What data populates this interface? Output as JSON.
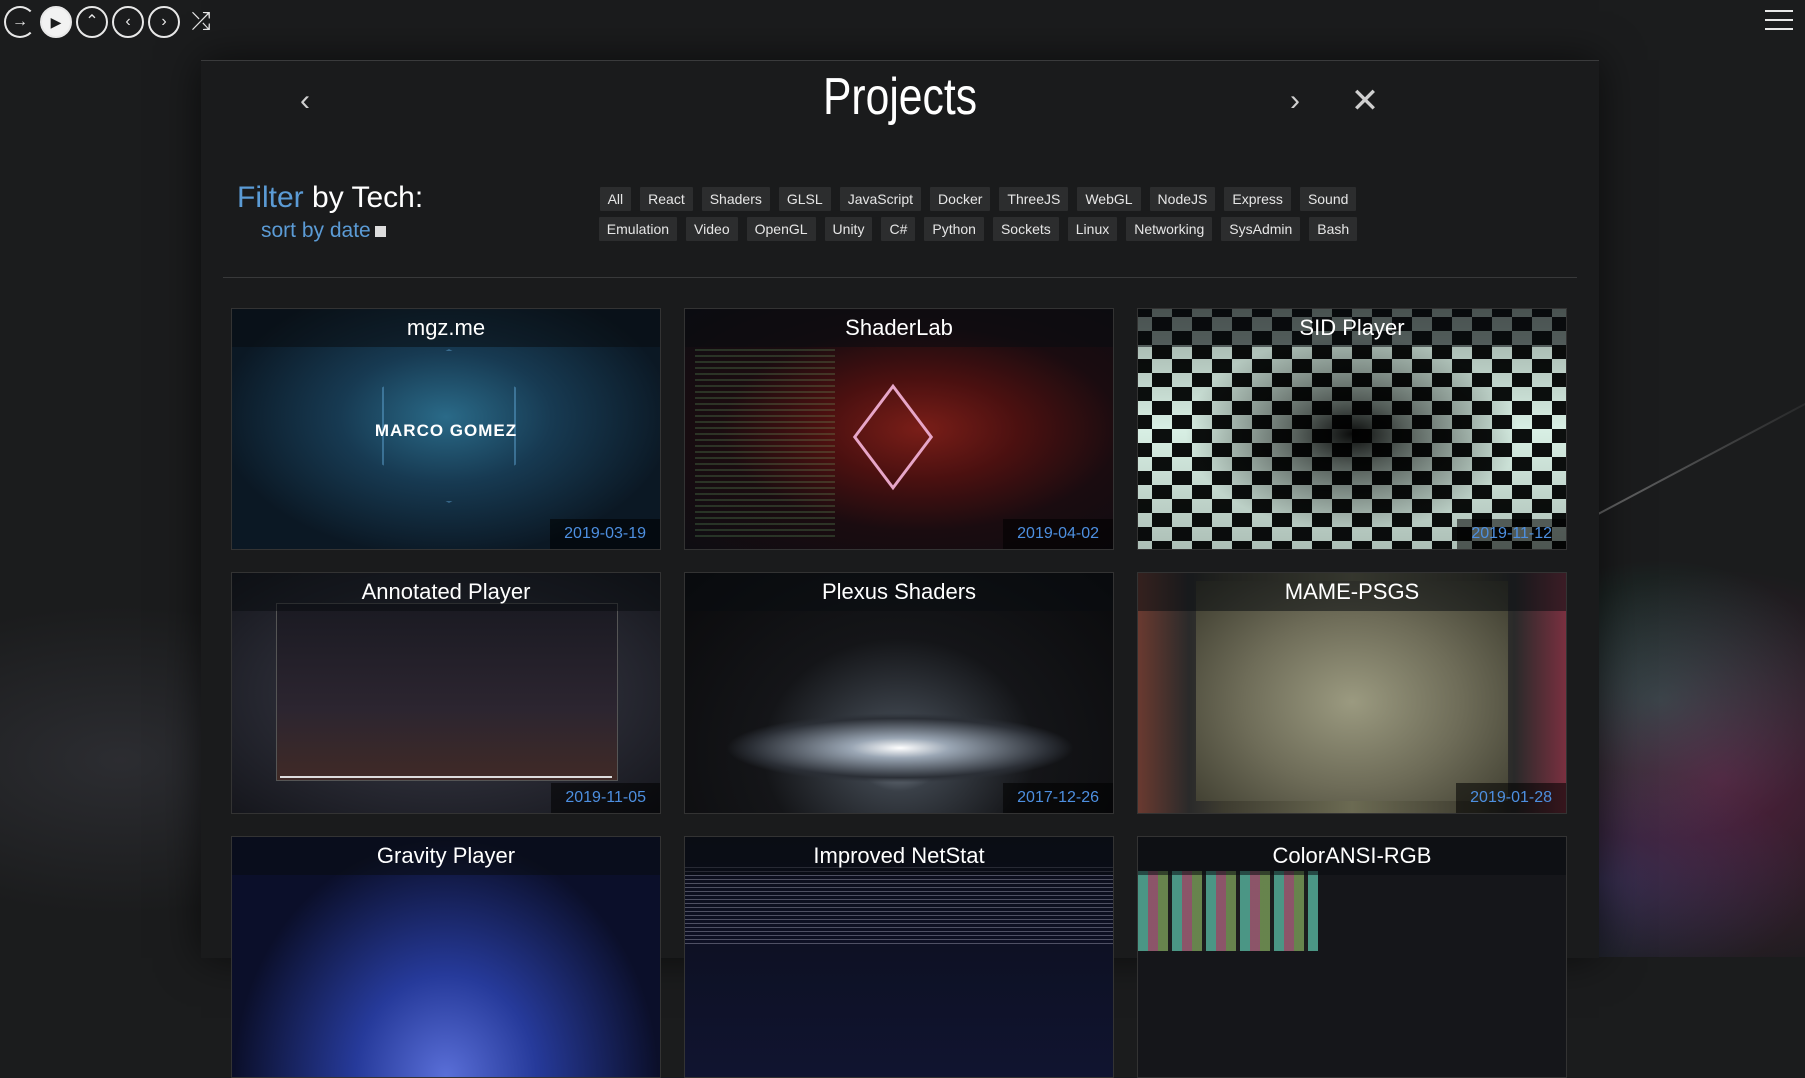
{
  "panel": {
    "title": "Projects",
    "filter_highlight": "Filter",
    "filter_rest": " by Tech:",
    "sort_label": "sort by date"
  },
  "tags_row1": [
    "All",
    "React",
    "Shaders",
    "GLSL",
    "JavaScript",
    "Docker",
    "ThreeJS",
    "WebGL",
    "NodeJS",
    "Express",
    "Sound"
  ],
  "tags_row2": [
    "Emulation",
    "Video",
    "OpenGL",
    "Unity",
    "C#",
    "Python",
    "Sockets",
    "Linux",
    "Networking",
    "SysAdmin",
    "Bash"
  ],
  "projects": [
    {
      "title": "mgz.me",
      "date": "2019-03-19",
      "thumb_text": "MARCO GOMEZ"
    },
    {
      "title": "ShaderLab",
      "date": "2019-04-02"
    },
    {
      "title": "SID Player",
      "date": "2019-11-12"
    },
    {
      "title": "Annotated Player",
      "date": "2019-11-05"
    },
    {
      "title": "Plexus Shaders",
      "date": "2017-12-26"
    },
    {
      "title": "MAME-PSGS",
      "date": "2019-01-28"
    },
    {
      "title": "Gravity Player"
    },
    {
      "title": "Improved NetStat"
    },
    {
      "title": "ColorANSI-RGB"
    }
  ],
  "colors": {
    "accent": "#5b9bd5",
    "date": "#4d8fe0",
    "background": "#1b1c1d"
  },
  "icons": {
    "exit": "exit-icon",
    "play": "play-icon",
    "up": "chevron-up-icon",
    "prev": "chevron-left-icon",
    "next": "chevron-right-icon",
    "shuffle": "shuffle-icon",
    "menu": "hamburger-menu-icon",
    "close": "close-icon"
  }
}
